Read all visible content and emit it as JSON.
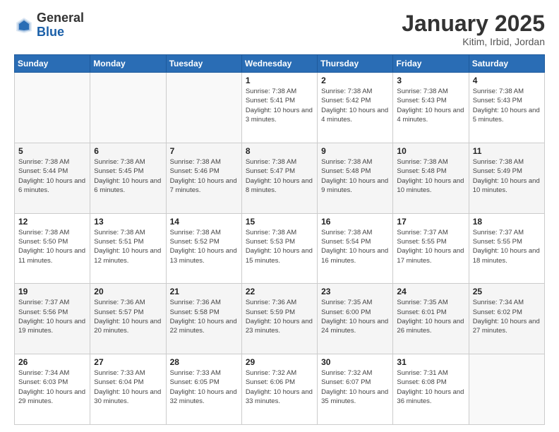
{
  "header": {
    "logo_general": "General",
    "logo_blue": "Blue",
    "title": "January 2025",
    "subtitle": "Kitim, Irbid, Jordan"
  },
  "weekdays": [
    "Sunday",
    "Monday",
    "Tuesday",
    "Wednesday",
    "Thursday",
    "Friday",
    "Saturday"
  ],
  "weeks": [
    [
      {
        "num": "",
        "info": ""
      },
      {
        "num": "",
        "info": ""
      },
      {
        "num": "",
        "info": ""
      },
      {
        "num": "1",
        "info": "Sunrise: 7:38 AM\nSunset: 5:41 PM\nDaylight: 10 hours\nand 3 minutes."
      },
      {
        "num": "2",
        "info": "Sunrise: 7:38 AM\nSunset: 5:42 PM\nDaylight: 10 hours\nand 4 minutes."
      },
      {
        "num": "3",
        "info": "Sunrise: 7:38 AM\nSunset: 5:43 PM\nDaylight: 10 hours\nand 4 minutes."
      },
      {
        "num": "4",
        "info": "Sunrise: 7:38 AM\nSunset: 5:43 PM\nDaylight: 10 hours\nand 5 minutes."
      }
    ],
    [
      {
        "num": "5",
        "info": "Sunrise: 7:38 AM\nSunset: 5:44 PM\nDaylight: 10 hours\nand 6 minutes."
      },
      {
        "num": "6",
        "info": "Sunrise: 7:38 AM\nSunset: 5:45 PM\nDaylight: 10 hours\nand 6 minutes."
      },
      {
        "num": "7",
        "info": "Sunrise: 7:38 AM\nSunset: 5:46 PM\nDaylight: 10 hours\nand 7 minutes."
      },
      {
        "num": "8",
        "info": "Sunrise: 7:38 AM\nSunset: 5:47 PM\nDaylight: 10 hours\nand 8 minutes."
      },
      {
        "num": "9",
        "info": "Sunrise: 7:38 AM\nSunset: 5:48 PM\nDaylight: 10 hours\nand 9 minutes."
      },
      {
        "num": "10",
        "info": "Sunrise: 7:38 AM\nSunset: 5:48 PM\nDaylight: 10 hours\nand 10 minutes."
      },
      {
        "num": "11",
        "info": "Sunrise: 7:38 AM\nSunset: 5:49 PM\nDaylight: 10 hours\nand 10 minutes."
      }
    ],
    [
      {
        "num": "12",
        "info": "Sunrise: 7:38 AM\nSunset: 5:50 PM\nDaylight: 10 hours\nand 11 minutes."
      },
      {
        "num": "13",
        "info": "Sunrise: 7:38 AM\nSunset: 5:51 PM\nDaylight: 10 hours\nand 12 minutes."
      },
      {
        "num": "14",
        "info": "Sunrise: 7:38 AM\nSunset: 5:52 PM\nDaylight: 10 hours\nand 13 minutes."
      },
      {
        "num": "15",
        "info": "Sunrise: 7:38 AM\nSunset: 5:53 PM\nDaylight: 10 hours\nand 15 minutes."
      },
      {
        "num": "16",
        "info": "Sunrise: 7:38 AM\nSunset: 5:54 PM\nDaylight: 10 hours\nand 16 minutes."
      },
      {
        "num": "17",
        "info": "Sunrise: 7:37 AM\nSunset: 5:55 PM\nDaylight: 10 hours\nand 17 minutes."
      },
      {
        "num": "18",
        "info": "Sunrise: 7:37 AM\nSunset: 5:55 PM\nDaylight: 10 hours\nand 18 minutes."
      }
    ],
    [
      {
        "num": "19",
        "info": "Sunrise: 7:37 AM\nSunset: 5:56 PM\nDaylight: 10 hours\nand 19 minutes."
      },
      {
        "num": "20",
        "info": "Sunrise: 7:36 AM\nSunset: 5:57 PM\nDaylight: 10 hours\nand 20 minutes."
      },
      {
        "num": "21",
        "info": "Sunrise: 7:36 AM\nSunset: 5:58 PM\nDaylight: 10 hours\nand 22 minutes."
      },
      {
        "num": "22",
        "info": "Sunrise: 7:36 AM\nSunset: 5:59 PM\nDaylight: 10 hours\nand 23 minutes."
      },
      {
        "num": "23",
        "info": "Sunrise: 7:35 AM\nSunset: 6:00 PM\nDaylight: 10 hours\nand 24 minutes."
      },
      {
        "num": "24",
        "info": "Sunrise: 7:35 AM\nSunset: 6:01 PM\nDaylight: 10 hours\nand 26 minutes."
      },
      {
        "num": "25",
        "info": "Sunrise: 7:34 AM\nSunset: 6:02 PM\nDaylight: 10 hours\nand 27 minutes."
      }
    ],
    [
      {
        "num": "26",
        "info": "Sunrise: 7:34 AM\nSunset: 6:03 PM\nDaylight: 10 hours\nand 29 minutes."
      },
      {
        "num": "27",
        "info": "Sunrise: 7:33 AM\nSunset: 6:04 PM\nDaylight: 10 hours\nand 30 minutes."
      },
      {
        "num": "28",
        "info": "Sunrise: 7:33 AM\nSunset: 6:05 PM\nDaylight: 10 hours\nand 32 minutes."
      },
      {
        "num": "29",
        "info": "Sunrise: 7:32 AM\nSunset: 6:06 PM\nDaylight: 10 hours\nand 33 minutes."
      },
      {
        "num": "30",
        "info": "Sunrise: 7:32 AM\nSunset: 6:07 PM\nDaylight: 10 hours\nand 35 minutes."
      },
      {
        "num": "31",
        "info": "Sunrise: 7:31 AM\nSunset: 6:08 PM\nDaylight: 10 hours\nand 36 minutes."
      },
      {
        "num": "",
        "info": ""
      }
    ]
  ]
}
